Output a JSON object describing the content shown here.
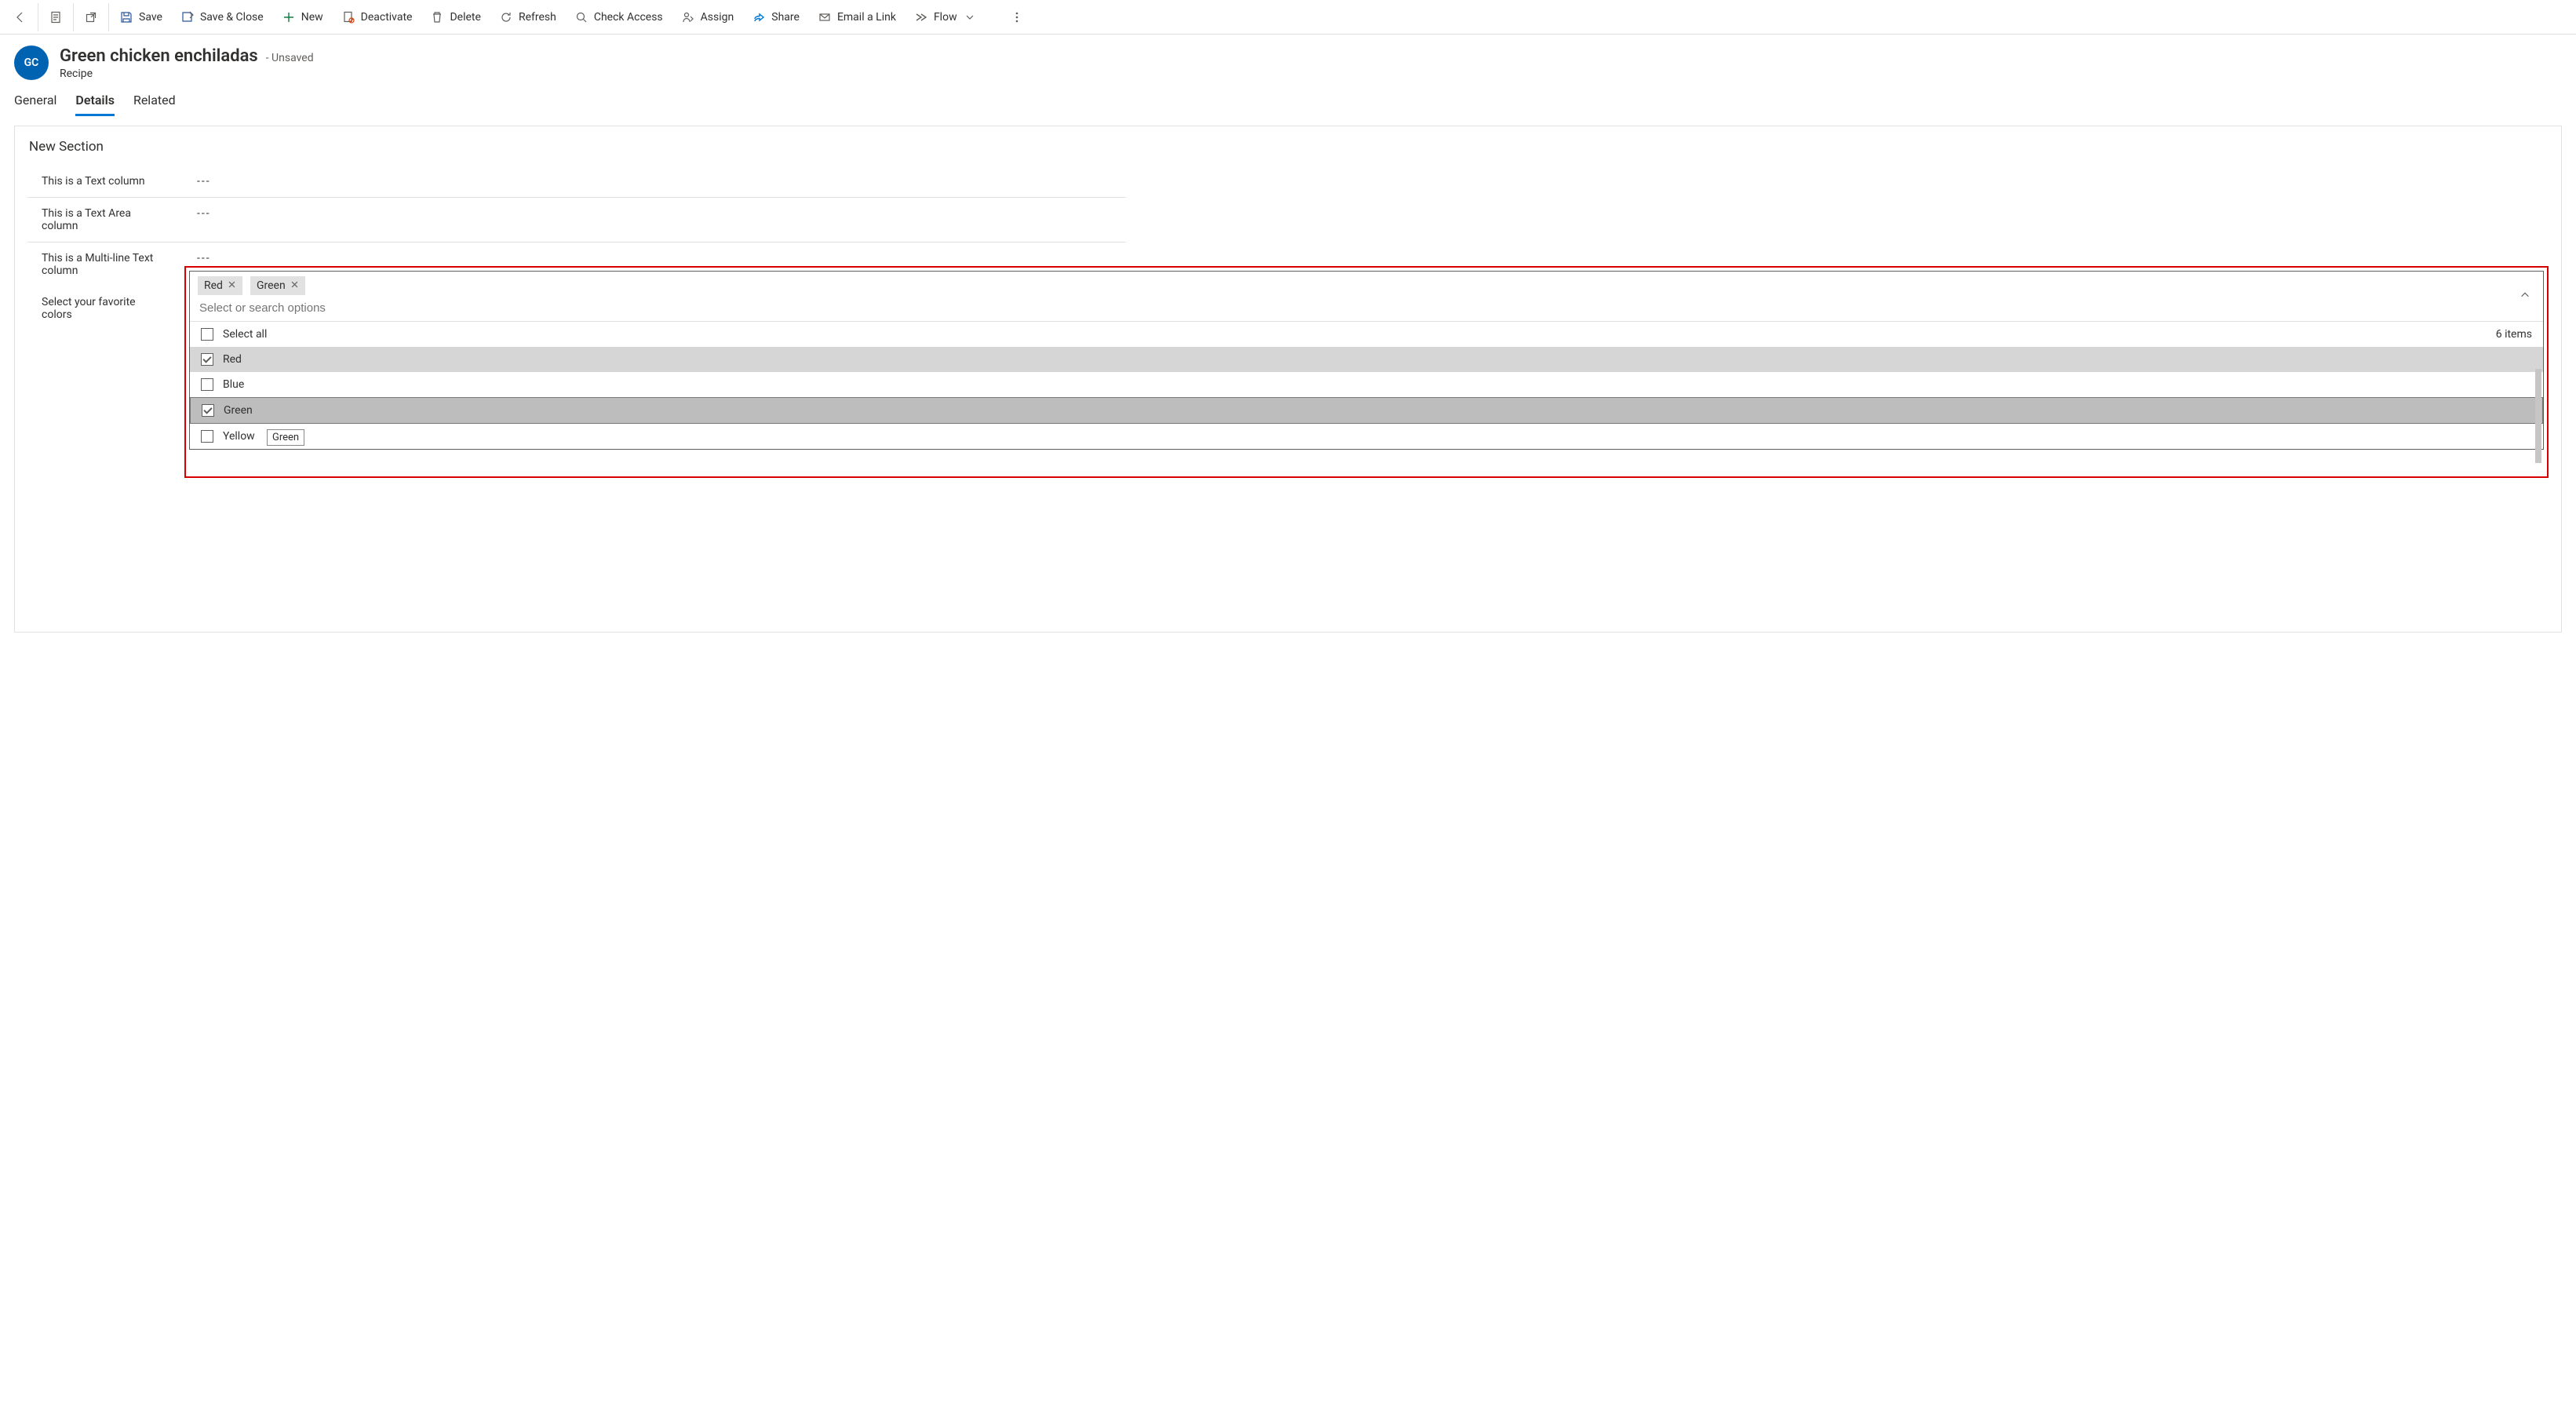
{
  "commands": {
    "save": "Save",
    "save_close": "Save & Close",
    "new": "New",
    "deactivate": "Deactivate",
    "delete": "Delete",
    "refresh": "Refresh",
    "check_access": "Check Access",
    "assign": "Assign",
    "share": "Share",
    "email_link": "Email a Link",
    "flow": "Flow"
  },
  "record": {
    "initials": "GC",
    "title": "Green chicken enchiladas",
    "state": "- Unsaved",
    "entity": "Recipe"
  },
  "tabs": {
    "general": "General",
    "details": "Details",
    "related": "Related"
  },
  "section": {
    "title": "New Section",
    "rows": [
      {
        "label": "This is a Text column",
        "value": "---"
      },
      {
        "label": "This is a Text Area column",
        "value": "---"
      },
      {
        "label": "This is a Multi-line Text column",
        "value": "---"
      }
    ],
    "multiselect_label": "Select your favorite colors"
  },
  "multiselect": {
    "placeholder": "Select or search options",
    "pills": [
      "Red",
      "Green"
    ],
    "select_all_label": "Select all",
    "count_label": "6 items",
    "options": [
      {
        "name": "Red",
        "checked": true,
        "state": "selected"
      },
      {
        "name": "Blue",
        "checked": false,
        "state": ""
      },
      {
        "name": "Green",
        "checked": true,
        "state": "focused"
      },
      {
        "name": "Yellow",
        "checked": false,
        "state": ""
      }
    ],
    "tooltip": "Green"
  }
}
